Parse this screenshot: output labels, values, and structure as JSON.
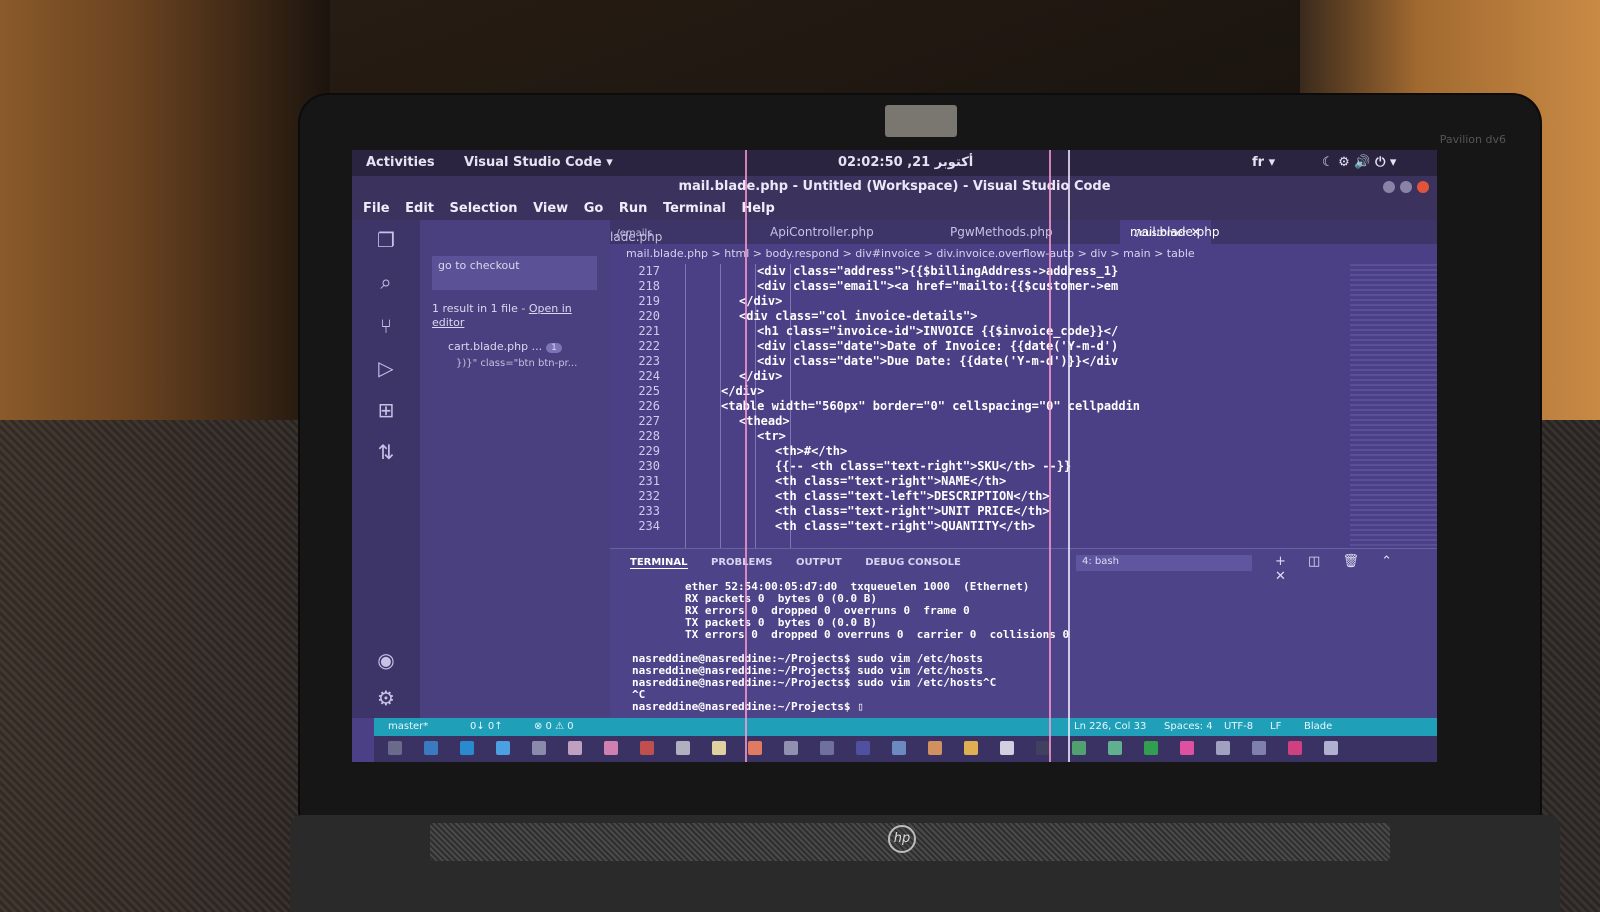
{
  "system": {
    "activities": "Activities",
    "app_menu": "Visual Studio Code ▾",
    "clock": "02:02:50 ,21 أكتوبر",
    "lang": "fr ▾"
  },
  "window": {
    "title": "mail.blade.php - Untitled (Workspace) - Visual Studio Code"
  },
  "menu": [
    "File",
    "Edit",
    "Selection",
    "View",
    "Go",
    "Run",
    "Terminal",
    "Help"
  ],
  "sidebar": {
    "search_value": "go to checkout",
    "result_summary": "1 result in 1 file - ",
    "open_in_editor": "Open in editor",
    "file_name": "cart.blade.php ...",
    "file_badge": "1",
    "match_text": "})}\" class=\"btn btn-pr..."
  },
  "tabs": [
    {
      "label": "lade.php",
      "hint": "../emails"
    },
    {
      "label": "ApiController.php"
    },
    {
      "label": "PgwMethods.php"
    },
    {
      "label": "mail.blade.php",
      "hint": "../customer",
      "active": true
    }
  ],
  "breadcrumb": "mail.blade.php > html > body.respond > div#invoice > div.invoice.overflow-auto > div > main > table",
  "editor": {
    "line_numbers": [
      "217",
      "218",
      "219",
      "220",
      "221",
      "222",
      "223",
      "224",
      "225",
      "226",
      "227",
      "228",
      "229",
      "230",
      "231",
      "232",
      "233",
      "234"
    ],
    "lines": [
      "<div class=\"address\">{{$billingAddress->address_1}",
      "<div class=\"email\"><a href=\"mailto:{{$customer->em",
      "</div>",
      "<div class=\"col invoice-details\">",
      "<h1 class=\"invoice-id\">INVOICE {{$invoice_code}}</",
      "<div class=\"date\">Date of Invoice: {{date('Y-m-d')",
      "<div class=\"date\">Due Date: {{date('Y-m-d')}}</div",
      "</div>",
      "</div>",
      "<table width=\"560px\" border=\"0\" cellspacing=\"0\" cellpaddin",
      "<thead>",
      "<tr>",
      "<th>#</th>",
      "{{-- <th class=\"text-right\">SKU</th> --}}",
      "<th class=\"text-right\">NAME</th>",
      "<th class=\"text-left\">DESCRIPTION</th>",
      "<th class=\"text-right\">UNIT PRICE</th>",
      "<th class=\"text-right\">QUANTITY</th>"
    ]
  },
  "panel": {
    "tabs": [
      "TERMINAL",
      "PROBLEMS",
      "OUTPUT",
      "DEBUG CONSOLE"
    ],
    "shell": "4: bash",
    "terminal_lines": [
      "        ether 52:54:00:05:d7:d0  txqueuelen 1000  (Ethernet)",
      "        RX packets 0  bytes 0 (0.0 B)",
      "        RX errors 0  dropped 0  overruns 0  frame 0",
      "        TX packets 0  bytes 0 (0.0 B)",
      "        TX errors 0  dropped 0 overruns 0  carrier 0  collisions 0",
      "",
      "nasreddine@nasreddine:~/Projects$ sudo vim /etc/hosts",
      "nasreddine@nasreddine:~/Projects$ sudo vim /etc/hosts",
      "nasreddine@nasreddine:~/Projects$ sudo vim /etc/hosts^C",
      "^C",
      "nasreddine@nasreddine:~/Projects$ ▯"
    ]
  },
  "status": {
    "branch": "master*",
    "sync": "0↓ 0↑",
    "problems": "⊗ 0 ⚠ 0",
    "position": "Ln 226, Col 33",
    "spaces": "Spaces: 4",
    "encoding": "UTF-8",
    "eol": "LF",
    "language": "Blade"
  },
  "hardware": {
    "brand_tr": "Pavilion dv6",
    "logo": "hp"
  },
  "colors": {
    "screen": "#4b4085",
    "statusbar": "#1fa0b8",
    "close": "#e0543a"
  }
}
